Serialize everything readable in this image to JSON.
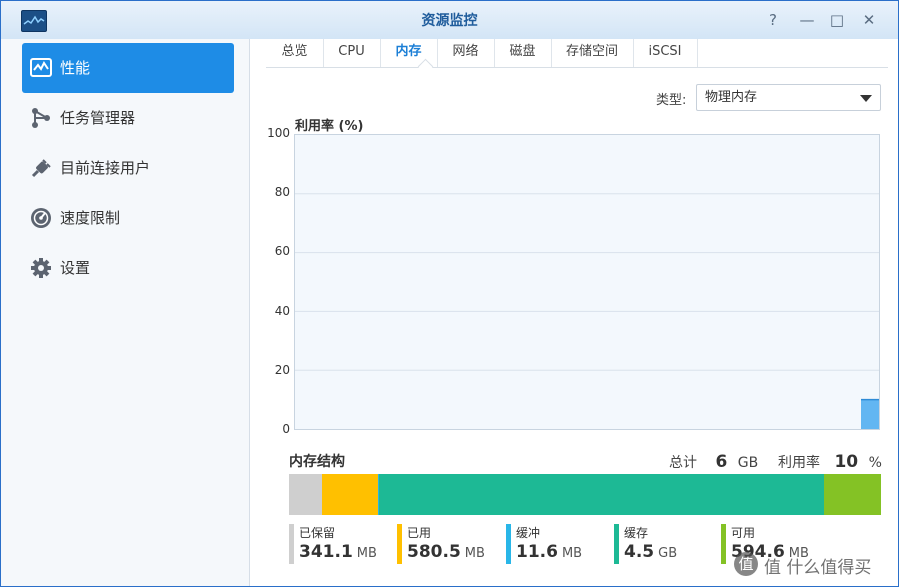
{
  "window": {
    "title": "资源监控",
    "controls": {
      "help": "?",
      "minimize": "—",
      "maximize": "□",
      "close": "✕"
    }
  },
  "sidebar": {
    "items": [
      {
        "label": "性能",
        "icon": "performance-chart-icon",
        "active": true
      },
      {
        "label": "任务管理器",
        "icon": "task-manager-icon",
        "active": false
      },
      {
        "label": "目前连接用户",
        "icon": "connected-users-plug-icon",
        "active": false
      },
      {
        "label": "速度限制",
        "icon": "speed-limit-gauge-icon",
        "active": false
      },
      {
        "label": "设置",
        "icon": "gear-icon",
        "active": false
      }
    ]
  },
  "tabs": [
    {
      "label": "总览",
      "active": false
    },
    {
      "label": "CPU",
      "active": false
    },
    {
      "label": "内存",
      "active": true
    },
    {
      "label": "网络",
      "active": false
    },
    {
      "label": "磁盘",
      "active": false
    },
    {
      "label": "存储空间",
      "active": false
    },
    {
      "label": "iSCSI",
      "active": false
    }
  ],
  "type_selector": {
    "label": "类型:",
    "value": "物理内存"
  },
  "chart": {
    "title": "利用率 (%)"
  },
  "chart_data": {
    "type": "area",
    "ylim": [
      0,
      100
    ],
    "yticks": [
      "100",
      "80",
      "60",
      "40",
      "20",
      "0"
    ],
    "grid": true,
    "series": [
      {
        "values": [
          10,
          10
        ]
      }
    ],
    "color": "#62b6f2"
  },
  "memory": {
    "section_title": "内存结构",
    "total_label": "总计",
    "total_value": "6",
    "total_unit": "GB",
    "usage_label": "利用率",
    "usage_value": "10",
    "usage_unit": "%",
    "segments": [
      {
        "name": "已保留",
        "value": "341.1",
        "unit": "MB",
        "color": "#cfcfcf",
        "fraction": 0.0555
      },
      {
        "name": "已用",
        "value": "580.5",
        "unit": "MB",
        "color": "#ffc000",
        "fraction": 0.0945
      },
      {
        "name": "缓冲",
        "value": "11.6",
        "unit": "MB",
        "color": "#29b6e8",
        "fraction": 0.0019
      },
      {
        "name": "缓存",
        "value": "4.5",
        "unit": "GB",
        "color": "#1db995",
        "fraction": 0.7509
      },
      {
        "name": "可用",
        "value": "594.6",
        "unit": "MB",
        "color": "#84c225",
        "fraction": 0.0972
      }
    ]
  },
  "watermark": {
    "text": "值 什么值得买",
    "logo": "值"
  }
}
